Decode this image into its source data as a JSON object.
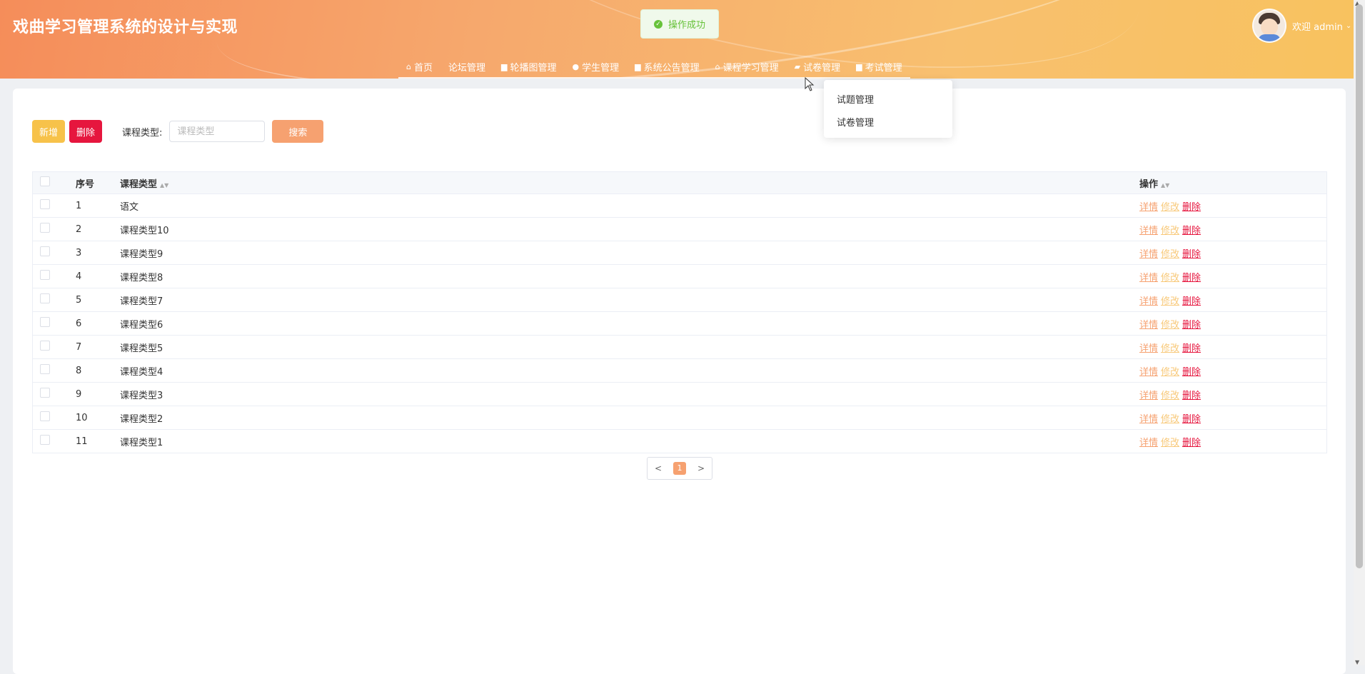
{
  "header": {
    "app_title": "戏曲学习管理系统的设计与实现",
    "toast": "操作成功",
    "welcome": "欢迎 admin"
  },
  "nav": [
    {
      "label": "首页",
      "icon": "home-icon"
    },
    {
      "label": "论坛管理",
      "icon": ""
    },
    {
      "label": "轮播图管理",
      "icon": "image-icon"
    },
    {
      "label": "学生管理",
      "icon": "user-icon"
    },
    {
      "label": "系统公告管理",
      "icon": "notice-icon"
    },
    {
      "label": "课程学习管理",
      "icon": "course-icon"
    },
    {
      "label": "试卷管理",
      "icon": "folder-icon"
    },
    {
      "label": "考试管理",
      "icon": "exam-icon"
    }
  ],
  "dropdown": {
    "items": [
      "试题管理",
      "试卷管理"
    ]
  },
  "toolbar": {
    "add_label": "新增",
    "delete_label": "删除",
    "filter_label": "课程类型:",
    "filter_placeholder": "课程类型",
    "search_label": "搜索"
  },
  "table": {
    "headers": {
      "no": "序号",
      "type": "课程类型",
      "op": "操作"
    },
    "rows": [
      {
        "no": "1",
        "type": "语文"
      },
      {
        "no": "2",
        "type": "课程类型10"
      },
      {
        "no": "3",
        "type": "课程类型9"
      },
      {
        "no": "4",
        "type": "课程类型8"
      },
      {
        "no": "5",
        "type": "课程类型7"
      },
      {
        "no": "6",
        "type": "课程类型6"
      },
      {
        "no": "7",
        "type": "课程类型5"
      },
      {
        "no": "8",
        "type": "课程类型4"
      },
      {
        "no": "9",
        "type": "课程类型3"
      },
      {
        "no": "10",
        "type": "课程类型2"
      },
      {
        "no": "11",
        "type": "课程类型1"
      }
    ],
    "ops": {
      "detail": "详情",
      "edit": "修改",
      "delete": "删除"
    }
  },
  "pagination": {
    "prev": "<",
    "current": "1",
    "next": ">"
  },
  "colors": {
    "accent": "#f6a170",
    "danger": "#e6163e",
    "warning": "#f7c24a",
    "success": "#67c23a"
  }
}
